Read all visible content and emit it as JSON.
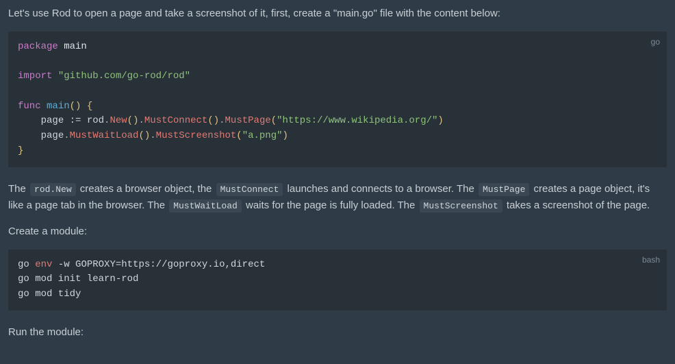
{
  "intro": "Let's use Rod to open a page and take a screenshot of it, first, create a \"main.go\" file with the content below:",
  "code1": {
    "lang": "go",
    "l1_kw": "package",
    "l1_pkg": " main",
    "l3_kw": "import",
    "l3_str": " \"github.com/go-rod/rod\"",
    "l5_kw": "func",
    "l5_fn": " main",
    "l5_br1": "()",
    "l5_br2": " {",
    "l6_indent": "    ",
    "l6_page": "page",
    "l6_op": " := ",
    "l6_rod": "rod",
    "l6_dot1": ".",
    "l6_new": "New",
    "l6_p1": "()",
    "l6_dot2": ".",
    "l6_mc": "MustConnect",
    "l6_p2": "()",
    "l6_dot3": ".",
    "l6_mp": "MustPage",
    "l6_p3o": "(",
    "l6_url": "\"https://www.wikipedia.org/\"",
    "l6_p3c": ")",
    "l7_indent": "    ",
    "l7_page": "page",
    "l7_dot1": ".",
    "l7_mwl": "MustWaitLoad",
    "l7_p1": "()",
    "l7_dot2": ".",
    "l7_ms": "MustScreenshot",
    "l7_p2o": "(",
    "l7_png": "\"a.png\"",
    "l7_p2c": ")",
    "l8_close": "}"
  },
  "para2": {
    "t1": "The ",
    "c1": "rod.New",
    "t2": " creates a browser object, the ",
    "c2": "MustConnect",
    "t3": " launches and connects to a browser. The ",
    "c3": "MustPage",
    "t4": " creates a page object, it's like a page tab in the browser. The ",
    "c4": "MustWaitLoad",
    "t5": " waits for the page is fully loaded. The ",
    "c5": "MustScreenshot",
    "t6": " takes a screenshot of the page."
  },
  "para3": "Create a module:",
  "code2": {
    "lang": "bash",
    "l1a": "go ",
    "l1env": "env",
    "l1b": " -w GOPROXY=https://goproxy.io,direct",
    "l2": "go mod init learn-rod",
    "l3": "go mod tidy"
  },
  "para4": "Run the module:"
}
